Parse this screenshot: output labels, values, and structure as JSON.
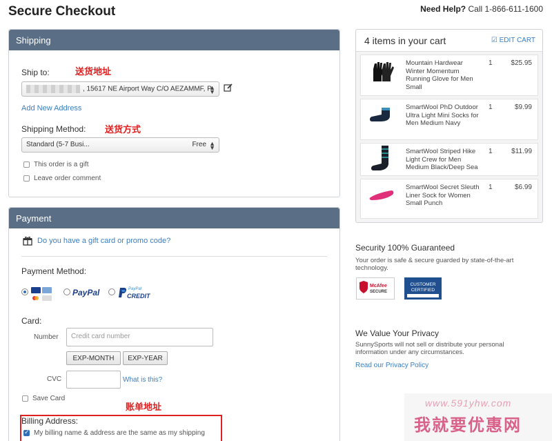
{
  "header": {
    "title": "Secure Checkout",
    "help_label": "Need Help?",
    "help_text": "Call 1-866-611-1600"
  },
  "shipping": {
    "section_title": "Shipping",
    "ship_to_label": "Ship to:",
    "ship_to_note_cn": "送货地址",
    "address_value": ", 15617 NE Airport Way C/O AEZAMMF, P",
    "add_new_address": "Add New Address",
    "method_label": "Shipping Method:",
    "method_note_cn": "送货方式",
    "method_value": "Standard (5-7 Busi...",
    "method_price": "Free",
    "gift_label": "This order is a gift",
    "comment_label": "Leave order comment"
  },
  "payment": {
    "section_title": "Payment",
    "gift_card_link": "Do you have a gift card or promo code?",
    "method_label": "Payment Method:",
    "paypal_label": "PayPal",
    "paypal_credit_top": "PayPal",
    "paypal_credit_label": "CREDIT",
    "card_label": "Card:",
    "number_label": "Number",
    "number_placeholder": "Credit card number",
    "exp_month": "EXP-MONTH",
    "exp_year": "EXP-YEAR",
    "cvc_label": "CVC",
    "what_is_this": "What is this?",
    "save_card": "Save Card",
    "billing_note_cn": "账单地址",
    "billing_label": "Billing Address:",
    "billing_same": "My billing name & address are the same as my shipping"
  },
  "cart": {
    "count_label": "4 items in your cart",
    "edit_label": "EDIT CART",
    "items": [
      {
        "name": "Mountain Hardwear Winter Momentum Running Glove for Men Small",
        "qty": "1",
        "price": "$25.95",
        "icon": "glove-icon"
      },
      {
        "name": "SmartWool PhD Outdoor Ultra Light Mini Socks for Men Medium Navy",
        "qty": "1",
        "price": "$9.99",
        "icon": "sock-icon"
      },
      {
        "name": "SmartWool Striped Hike Light Crew for Men Medium Black/Deep Sea",
        "qty": "1",
        "price": "$11.99",
        "icon": "sock-icon"
      },
      {
        "name": "SmartWool Secret Sleuth Liner Sock for Women Small Punch",
        "qty": "1",
        "price": "$6.99",
        "icon": "sock-icon"
      }
    ]
  },
  "security": {
    "title": "Security 100% Guaranteed",
    "text": "Your order is safe & secure guarded by state-of-the-art technology."
  },
  "privacy": {
    "title": "We Value Your Privacy",
    "text": "SunnySports will not sell or distribute your personal information under any circumstances.",
    "link": "Read our Privacy Policy"
  },
  "watermark": {
    "url": "www.591yhw.com",
    "cn": "我就要优惠网"
  }
}
